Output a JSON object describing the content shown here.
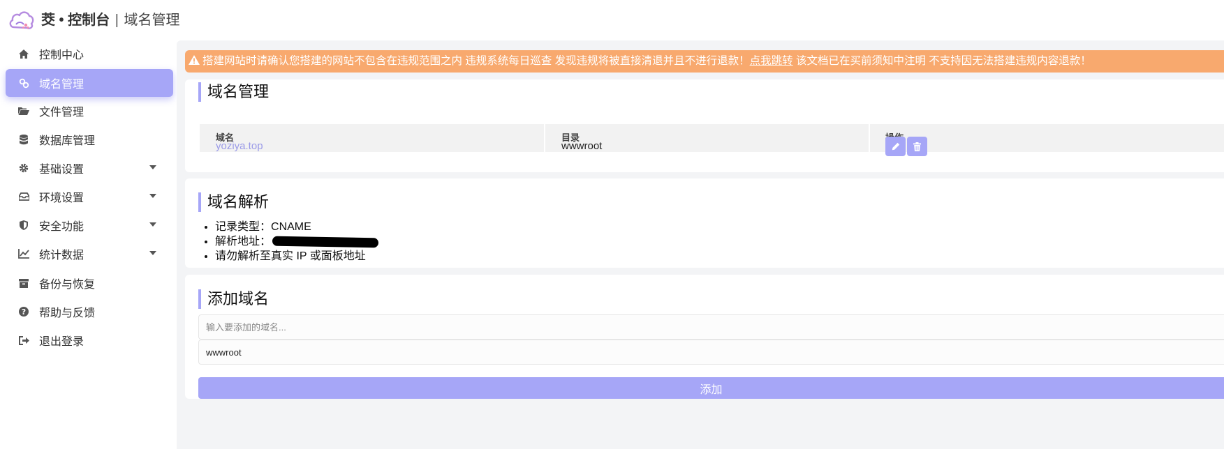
{
  "header": {
    "brand_name": "茭 • 控制台",
    "separator": "|",
    "page_title": "域名管理"
  },
  "sidebar": {
    "items": [
      {
        "label": "控制中心",
        "icon": "home-icon",
        "has_caret": false,
        "active": false
      },
      {
        "label": "域名管理",
        "icon": "link-icon",
        "has_caret": false,
        "active": true
      },
      {
        "label": "文件管理",
        "icon": "folder-open-icon",
        "has_caret": false,
        "active": false
      },
      {
        "label": "数据库管理",
        "icon": "database-icon",
        "has_caret": false,
        "active": false
      },
      {
        "label": "基础设置",
        "icon": "gear-icon",
        "has_caret": true,
        "active": false
      },
      {
        "label": "环境设置",
        "icon": "inbox-icon",
        "has_caret": true,
        "active": false
      },
      {
        "label": "安全功能",
        "icon": "shield-icon",
        "has_caret": true,
        "active": false
      },
      {
        "label": "统计数据",
        "icon": "line-chart-icon",
        "has_caret": true,
        "active": false
      },
      {
        "label": "备份与恢复",
        "icon": "archive-icon",
        "has_caret": false,
        "active": false
      },
      {
        "label": "帮助与反馈",
        "icon": "question-circle-icon",
        "has_caret": false,
        "active": false
      },
      {
        "label": "退出登录",
        "icon": "sign-out-icon",
        "has_caret": false,
        "active": false
      }
    ]
  },
  "alert": {
    "icon": "warning-icon",
    "text_before": "搭建网站时请确认您搭建的网站不包含在违规范围之内 违规系统每日巡查 发现违规将被直接清退并且不进行退款！",
    "link_text": "点我跳转",
    "text_after": " 该文档已在买前须知中注明 不支持因无法搭建违规内容退款！"
  },
  "domains_card": {
    "title": "域名管理",
    "columns": [
      "域名",
      "目录",
      "操作"
    ],
    "rows": [
      {
        "domain": "yoziya.top",
        "directory": "wwwroot"
      }
    ],
    "edit_icon": "pencil-icon",
    "delete_icon": "trash-icon"
  },
  "dns_card": {
    "title": "域名解析",
    "record_type_label": "记录类型：",
    "record_type_value": "CNAME",
    "address_label": "解析地址：",
    "note": "请勿解析至真实 IP 或面板地址"
  },
  "add_card": {
    "title": "添加域名",
    "domain_placeholder": "输入要添加的域名...",
    "directory_value": "wwwroot",
    "submit_label": "添加"
  },
  "colors": {
    "accent": "#a6a6f7",
    "alert_bg": "#f8a96e",
    "main_bg": "#f3f4f6"
  }
}
